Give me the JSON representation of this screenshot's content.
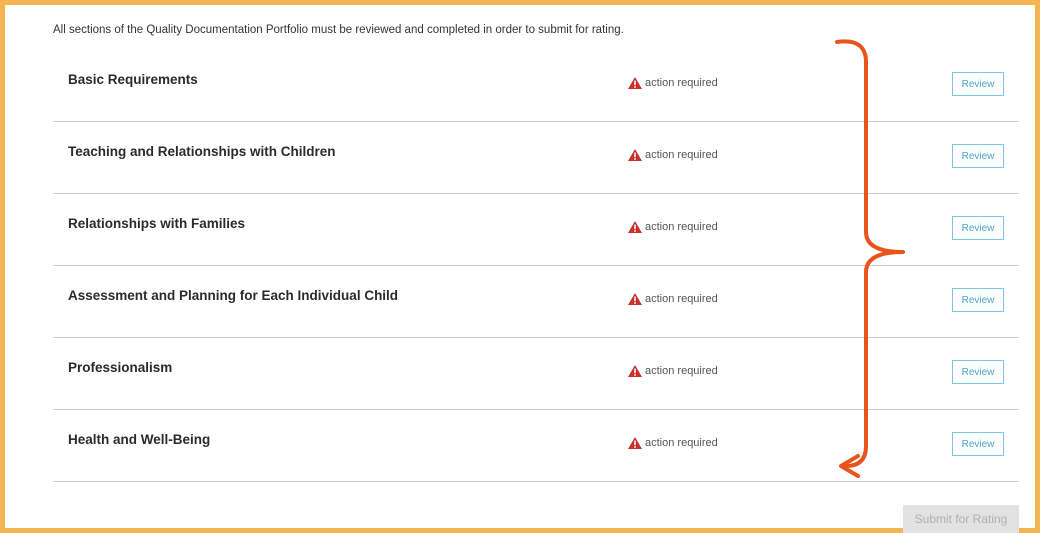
{
  "intro_text": "All sections of the Quality Documentation Portfolio must be reviewed and completed in order to submit for rating.",
  "sections": [
    {
      "name": "Basic Requirements",
      "status": "action required",
      "button": "Review"
    },
    {
      "name": "Teaching and Relationships with Children",
      "status": "action required",
      "button": "Review"
    },
    {
      "name": "Relationships with Families",
      "status": "action required",
      "button": "Review"
    },
    {
      "name": "Assessment and Planning for Each Individual Child",
      "status": "action required",
      "button": "Review"
    },
    {
      "name": "Professionalism",
      "status": "action required",
      "button": "Review"
    },
    {
      "name": "Health and Well-Being",
      "status": "action required",
      "button": "Review"
    }
  ],
  "submit_label": "Submit for Rating",
  "colors": {
    "frame_border": "#f3b552",
    "annotation": "#e8541c",
    "warning": "#c9302c",
    "review_border": "#7cc6e3",
    "review_text": "#4aa6cf"
  },
  "icons": {
    "status": "warning-triangle-icon"
  }
}
